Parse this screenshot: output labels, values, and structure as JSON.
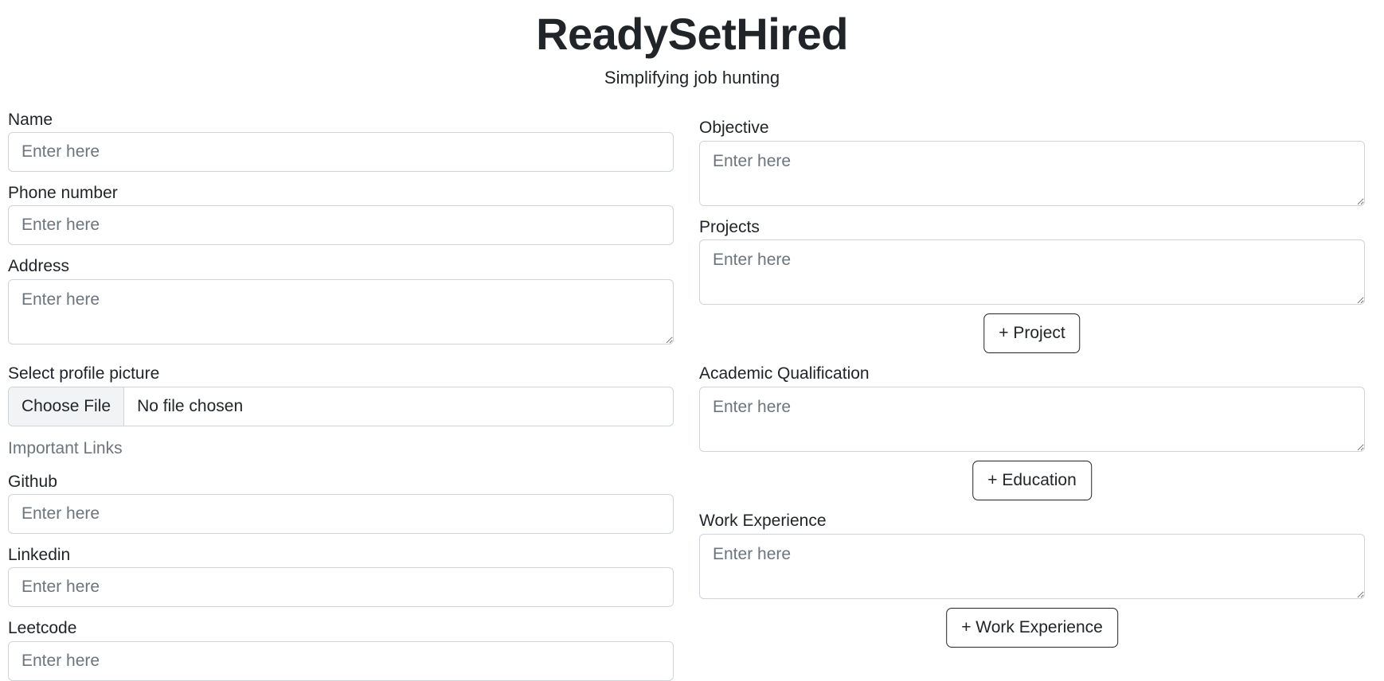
{
  "header": {
    "title": "ReadySetHired",
    "subtitle": "Simplifying job hunting"
  },
  "left": {
    "name": {
      "label": "Name",
      "placeholder": "Enter here"
    },
    "phone": {
      "label": "Phone number",
      "placeholder": "Enter here"
    },
    "address": {
      "label": "Address",
      "placeholder": "Enter here"
    },
    "profile_picture": {
      "label": "Select profile picture",
      "button": "Choose File",
      "status": "No file chosen"
    },
    "links_heading": "Important Links",
    "github": {
      "label": "Github",
      "placeholder": "Enter here"
    },
    "linkedin": {
      "label": "Linkedin",
      "placeholder": "Enter here"
    },
    "leetcode": {
      "label": "Leetcode",
      "placeholder": "Enter here"
    }
  },
  "right": {
    "objective": {
      "label": "Objective",
      "placeholder": "Enter here"
    },
    "projects": {
      "label": "Projects",
      "placeholder": "Enter here",
      "add_button": "+ Project"
    },
    "academic": {
      "label": "Academic Qualification",
      "placeholder": "Enter here",
      "add_button": "+ Education"
    },
    "work": {
      "label": "Work Experience",
      "placeholder": "Enter here",
      "add_button": "+ Work Experience"
    }
  }
}
